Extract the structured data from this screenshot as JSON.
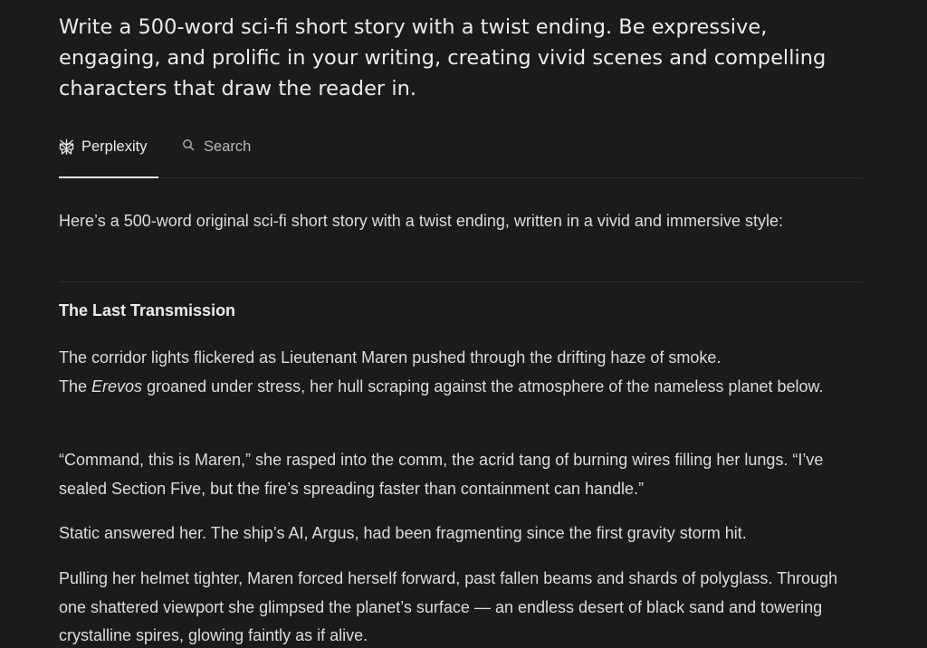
{
  "query": {
    "text": "Write a 500-word sci-fi short story with a twist ending. Be expressive, engaging, and prolific in your writing, creating vivid scenes and compelling characters that draw the reader in."
  },
  "tabs": {
    "answer_label": "Perplexity",
    "search_label": "Search"
  },
  "answer": {
    "intro": "Here’s a 500-word original sci-fi short story with a twist ending, written in a vivid and immersive style:",
    "story_title": "The Last Transmission",
    "p1_line1": "The corridor lights flickered as Lieutenant Maren pushed through the drifting haze of smoke.",
    "p1_the": "The ",
    "p1_ship": "Erevos",
    "p1_rest": " groaned under stress, her hull scraping against the atmosphere of the nameless planet below.",
    "p2": "“Command, this is Maren,” she rasped into the comm, the acrid tang of burning wires filling her lungs. “I’ve sealed Section Five, but the fire’s spreading faster than containment can handle.”",
    "p3": "Static answered her. The ship’s AI, Argus, had been fragmenting since the first gravity storm hit.",
    "p4": "Pulling her helmet tighter, Maren forced herself forward, past fallen beams and shards of polyglass. Through one shattered viewport she glimpsed the planet’s surface — an endless desert of black sand and towering crystalline spires, glowing faintly as if alive."
  },
  "icons": {
    "answer_tab_icon": "perplexity-logo-icon",
    "search_tab_icon": "search-icon"
  }
}
